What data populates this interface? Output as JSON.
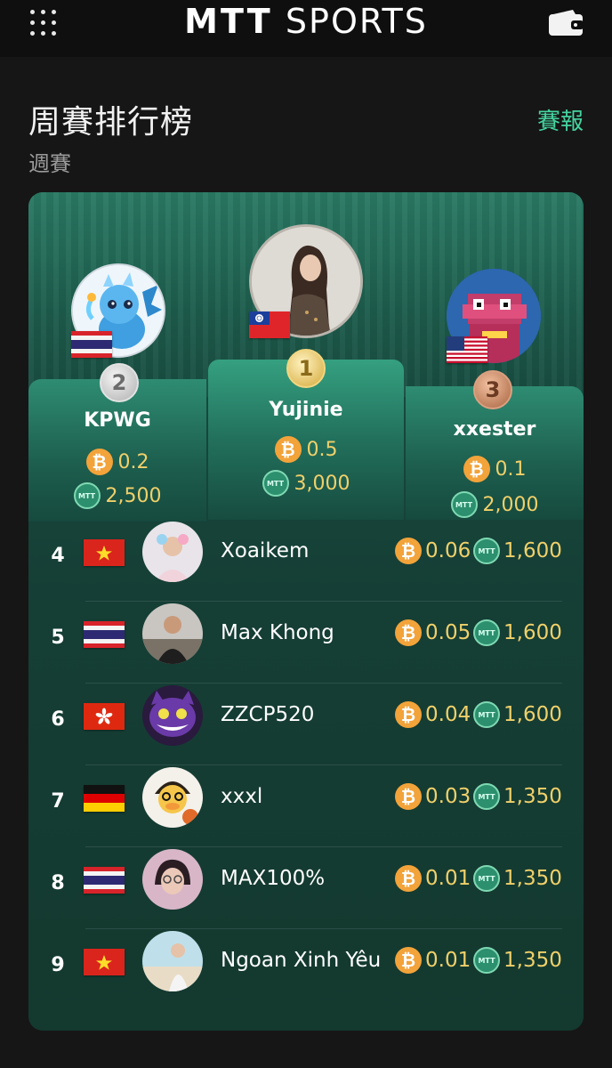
{
  "app": {
    "logo_mtt": "MTT",
    "logo_sports": "SPORTS"
  },
  "header": {
    "title": "周賽排行榜",
    "subtitle": "週賽",
    "report_link": "賽報"
  },
  "coins": {
    "btc_symbol": "₿",
    "mtt_symbol": "MTT"
  },
  "top3": [
    {
      "rank": "2",
      "name": "KPWG",
      "btc": "0.2",
      "mtt": "2,500",
      "country": "Thailand"
    },
    {
      "rank": "1",
      "name": "Yujinie",
      "btc": "0.5",
      "mtt": "3,000",
      "country": "Taiwan"
    },
    {
      "rank": "3",
      "name": "xxester",
      "btc": "0.1",
      "mtt": "2,000",
      "country": "United States"
    }
  ],
  "rows": [
    {
      "rank": "4",
      "name": "Xoaikem",
      "btc": "0.06",
      "mtt": "1,600",
      "country": "Vietnam"
    },
    {
      "rank": "5",
      "name": "Max Khong",
      "btc": "0.05",
      "mtt": "1,600",
      "country": "Thailand"
    },
    {
      "rank": "6",
      "name": "ZZCP520",
      "btc": "0.04",
      "mtt": "1,600",
      "country": "Hong Kong"
    },
    {
      "rank": "7",
      "name": "xxxl",
      "btc": "0.03",
      "mtt": "1,350",
      "country": "Germany"
    },
    {
      "rank": "8",
      "name": "MAX100%",
      "btc": "0.01",
      "mtt": "1,350",
      "country": "Thailand"
    },
    {
      "rank": "9",
      "name": "Ngoan Xinh Yêu",
      "btc": "0.01",
      "mtt": "1,350",
      "country": "Vietnam"
    }
  ],
  "colors": {
    "accent": "#45d4a0",
    "prize": "#f0d06a",
    "btc": "#f2a33a",
    "gold": "#e2c060",
    "silver": "#d0d0d0",
    "bronze": "#c07a55"
  }
}
